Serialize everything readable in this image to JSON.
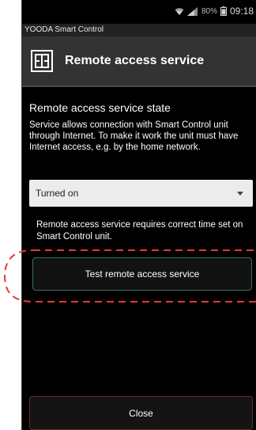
{
  "status_bar": {
    "battery": "80%",
    "time": "09:18"
  },
  "app": {
    "name": "YOODA Smart Control"
  },
  "title_bar": {
    "title": "Remote access service",
    "icon": "door-icon"
  },
  "section": {
    "title": "Remote access service state",
    "description": "Service allows connection with Smart Control unit through Internet. To make it work the unit must have Internet access, e.g. by the home network."
  },
  "state_select": {
    "selected": "Turned on"
  },
  "info": {
    "text": "Remote access service requires correct time set on Smart Control unit."
  },
  "buttons": {
    "test_label": "Test remote access service",
    "close_label": "Close"
  },
  "colors": {
    "highlight": "#e53935",
    "test_border": "#3f6e66",
    "close_border": "#6a2c2c"
  }
}
